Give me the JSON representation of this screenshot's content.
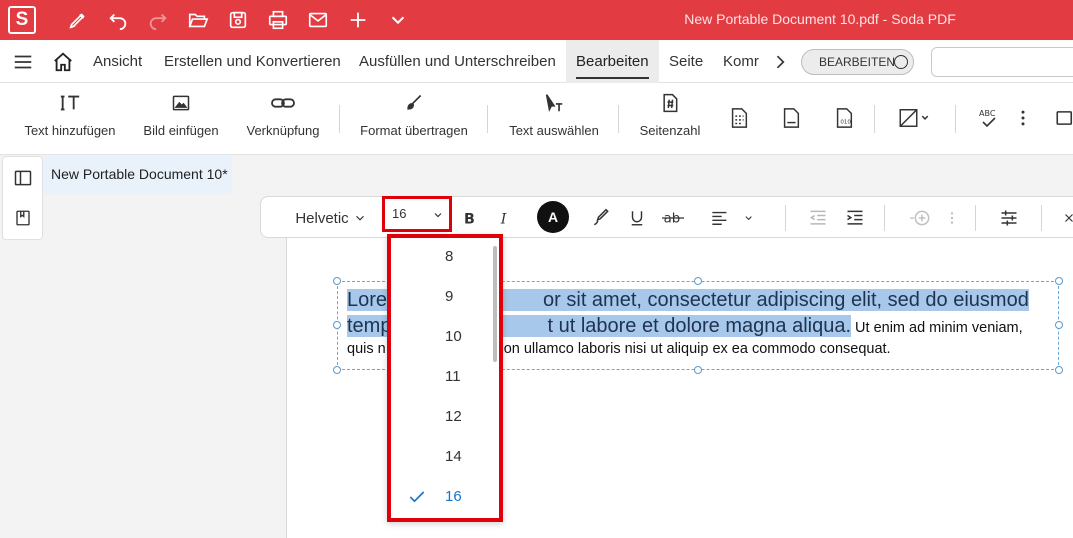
{
  "window": {
    "title": "New Portable Document 10.pdf  -  Soda PDF",
    "logo_letter": "S"
  },
  "quick_access": {
    "icons": [
      "pen-icon",
      "undo-icon",
      "redo-icon",
      "open-folder-icon",
      "save-icon",
      "print-icon",
      "mail-icon",
      "add-icon",
      "chevron-down-icon"
    ]
  },
  "menu": {
    "items": [
      "Ansicht",
      "Erstellen und Konvertieren",
      "Ausfüllen und Unterschreiben",
      "Bearbeiten",
      "Seite",
      "Komr"
    ],
    "active": "Bearbeiten",
    "mode_toggle_label": "BEARBEITEN"
  },
  "ribbon": {
    "buttons": [
      "Text hinzufügen",
      "Bild einfügen",
      "Verknüpfung",
      "Format übertragen",
      "Text auswählen",
      "Seitenzahl"
    ]
  },
  "document_tab": {
    "label": "New Portable Document 10*"
  },
  "format_bar": {
    "font": "Helvetic",
    "font_size": "16",
    "text_color_label": "A"
  },
  "font_size_dropdown": {
    "options": [
      "8",
      "9",
      "10",
      "11",
      "12",
      "14",
      "16"
    ],
    "selected": "16"
  },
  "document_text": {
    "line1_a": "Lore",
    "line1_b": "or sit amet, consectetur adipiscing elit, sed do eiusmod",
    "line2_a": "temp",
    "line2_b": "t ut labore et dolore magna aliqua.",
    "line2_c": " Ut enim ad minim veniam,",
    "line3_a": "quis n",
    "line3_b": "on ullamco laboris nisi ut aliquip ex ea commodo consequat."
  }
}
